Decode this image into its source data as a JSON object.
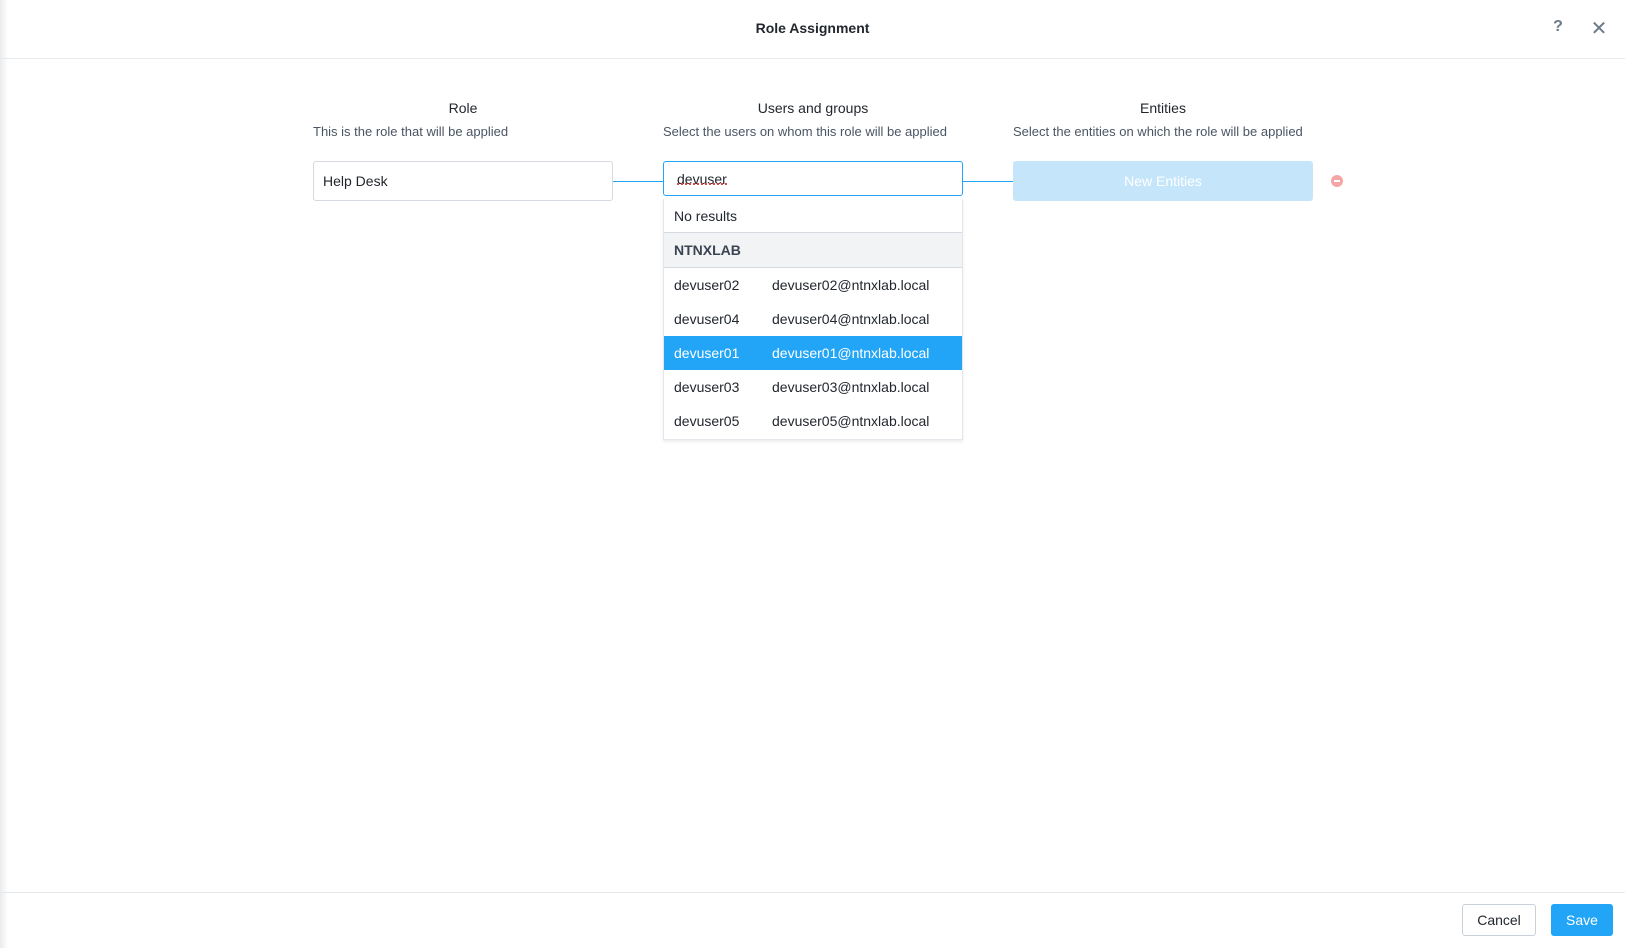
{
  "header": {
    "title": "Role Assignment",
    "help_icon": "?",
    "close_icon": "✕"
  },
  "columns": {
    "role": {
      "heading": "Role",
      "description": "This is the role that will be applied",
      "value": "Help Desk"
    },
    "users": {
      "heading": "Users and groups",
      "description": "Select the users on whom this role will be applied",
      "search_value": "devuser"
    },
    "entities": {
      "heading": "Entities",
      "description": "Select the entities on which the role will be applied",
      "button_label": "New Entities"
    }
  },
  "dropdown": {
    "no_results": "No results",
    "group": "NTNXLAB",
    "items": [
      {
        "name": "devuser02",
        "email": "devuser02@ntnxlab.local",
        "selected": false
      },
      {
        "name": "devuser04",
        "email": "devuser04@ntnxlab.local",
        "selected": false
      },
      {
        "name": "devuser01",
        "email": "devuser01@ntnxlab.local",
        "selected": true
      },
      {
        "name": "devuser03",
        "email": "devuser03@ntnxlab.local",
        "selected": false
      },
      {
        "name": "devuser05",
        "email": "devuser05@ntnxlab.local",
        "selected": false
      }
    ]
  },
  "footer": {
    "cancel_label": "Cancel",
    "save_label": "Save"
  },
  "colors": {
    "accent": "#22a5f7",
    "entities_button_disabled": "#c5e5fb",
    "remove_icon": "#f4a6a6"
  }
}
